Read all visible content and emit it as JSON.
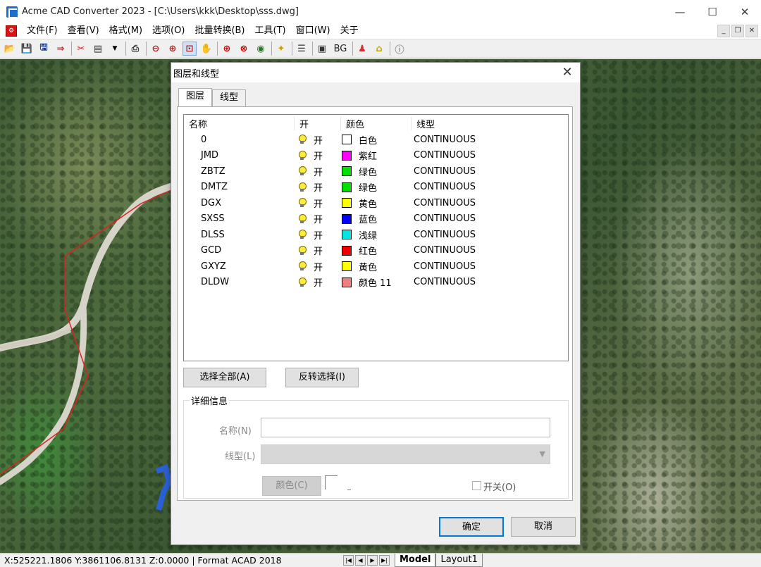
{
  "window": {
    "title": "Acme CAD Converter 2023 - [C:\\Users\\kkk\\Desktop\\sss.dwg]",
    "minimize": "—",
    "maximize": "☐",
    "close": "✕"
  },
  "menu": {
    "items": [
      "文件(F)",
      "查看(V)",
      "格式(M)",
      "选项(O)",
      "批量转换(B)",
      "工具(T)",
      "窗口(W)",
      "关于"
    ]
  },
  "toolbar": {
    "bg_label": "BG"
  },
  "dialog": {
    "title": "图层和线型",
    "close": "✕",
    "tabs": [
      "图层",
      "线型"
    ],
    "columns": {
      "name": "名称",
      "on": "开",
      "color": "颜色",
      "linetype": "线型"
    },
    "layers": [
      {
        "name": "0",
        "on": "开",
        "color_name": "白色",
        "color": "#ffffff",
        "linetype": "CONTINUOUS"
      },
      {
        "name": "JMD",
        "on": "开",
        "color_name": "紫红",
        "color": "#ff00ff",
        "linetype": "CONTINUOUS"
      },
      {
        "name": "ZBTZ",
        "on": "开",
        "color_name": "绿色",
        "color": "#00e000",
        "linetype": "CONTINUOUS"
      },
      {
        "name": "DMTZ",
        "on": "开",
        "color_name": "绿色",
        "color": "#00e000",
        "linetype": "CONTINUOUS"
      },
      {
        "name": "DGX",
        "on": "开",
        "color_name": "黄色",
        "color": "#ffff00",
        "linetype": "CONTINUOUS"
      },
      {
        "name": "SXSS",
        "on": "开",
        "color_name": "蓝色",
        "color": "#0000ff",
        "linetype": "CONTINUOUS"
      },
      {
        "name": "DLSS",
        "on": "开",
        "color_name": "浅绿",
        "color": "#00e5e5",
        "linetype": "CONTINUOUS"
      },
      {
        "name": "GCD",
        "on": "开",
        "color_name": "红色",
        "color": "#ee0000",
        "linetype": "CONTINUOUS"
      },
      {
        "name": "GXYZ",
        "on": "开",
        "color_name": "黄色",
        "color": "#ffff00",
        "linetype": "CONTINUOUS"
      },
      {
        "name": "DLDW",
        "on": "开",
        "color_name": "颜色 11",
        "color": "#f08080",
        "linetype": "CONTINUOUS"
      }
    ],
    "select_all": "选择全部(A)",
    "invert_selection": "反转选择(I)",
    "details": {
      "legend": "详细信息",
      "name_label": "名称(N)",
      "name_value": "",
      "linetype_label": "线型(L)",
      "color_button": "颜色(C)",
      "switch_label": "开关(O)"
    },
    "ok": "确定",
    "cancel": "取消"
  },
  "status": {
    "coords": "X:525221.1806 Y:3861106.8131 Z:0.0000 | Format ACAD 2018",
    "tabs": [
      "Model",
      "Layout1"
    ]
  }
}
